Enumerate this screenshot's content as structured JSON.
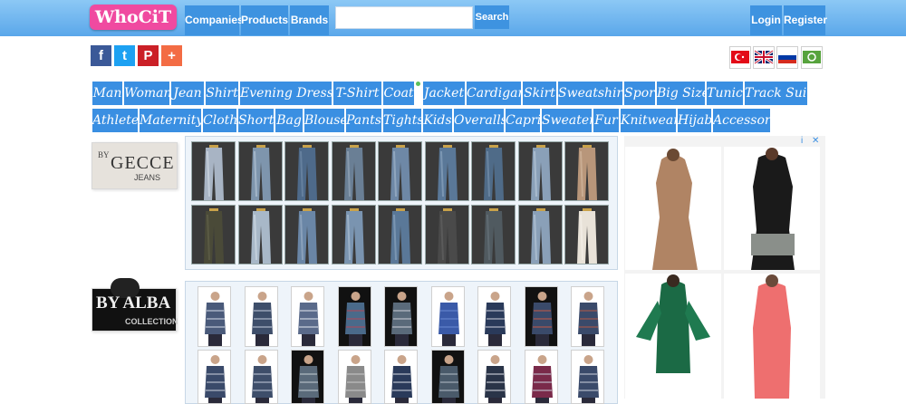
{
  "header": {
    "logo": "WhoCiT",
    "nav": [
      "Companies",
      "Products",
      "Brands"
    ],
    "search": {
      "value": "",
      "placeholder": "",
      "button": "Search"
    },
    "login": "Login",
    "register": "Register"
  },
  "social": [
    {
      "icon": "facebook-icon",
      "glyph": "f",
      "color": "#3b5998"
    },
    {
      "icon": "twitter-icon",
      "glyph": "t",
      "color": "#1da1f2"
    },
    {
      "icon": "pinterest-icon",
      "glyph": "P",
      "color": "#cb2027"
    },
    {
      "icon": "share-plus-icon",
      "glyph": "+",
      "color": "#f36c44"
    }
  ],
  "languages": [
    "turkish-flag-icon",
    "english-flag-icon",
    "russian-flag-icon",
    "arabic-flag-icon"
  ],
  "categories": {
    "row1": [
      "Man",
      "Woman",
      "Jean",
      "Shirt",
      "Evening Dresses",
      "T-Shirt",
      "Coat",
      "Jacket",
      "Cardigan",
      "Skirt",
      "Sweatshirt",
      "Spor",
      "Big Size",
      "Tunic",
      "Track Suit"
    ],
    "row2": [
      "Athlete",
      "Maternity",
      "Cloth",
      "Short",
      "Bag",
      "Blouse",
      "Pants",
      "Tights",
      "Kids",
      "Overalls",
      "Capri",
      "Sweater",
      "Fur",
      "Knitwear",
      "Hijab",
      "Accessory"
    ]
  },
  "brands": [
    {
      "name": "GECCE",
      "logo_top": "BY",
      "logo_main": "GECCE",
      "logo_sub": "JEANS"
    },
    {
      "name": "BY ALBA COLLECTION",
      "logo_top": "",
      "logo_main": "BY ALBA",
      "logo_sub": "COLLECTION"
    }
  ],
  "ad": {
    "close_glyph": "✕",
    "info_glyph": "i"
  },
  "colors": {
    "header": "#5aa7ea",
    "button": "#3e93e0",
    "category": "#3a8fe2",
    "logo": "#f04aa0"
  }
}
